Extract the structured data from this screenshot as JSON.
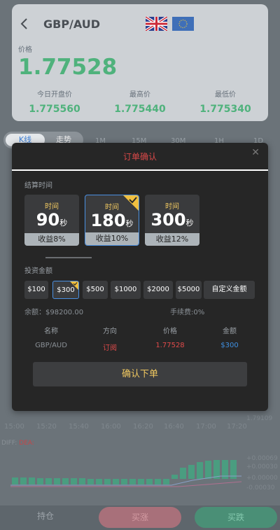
{
  "header": {
    "pair": "GBP/AUD",
    "price_label": "价格",
    "price": "1.77528",
    "stats": [
      {
        "label": "今日开盘价",
        "value": "1.775560"
      },
      {
        "label": "最高价",
        "value": "1.775440"
      },
      {
        "label": "最低价",
        "value": "1.775340"
      }
    ]
  },
  "chart_tabs": {
    "active": "K线",
    "other": "走势"
  },
  "periods": [
    "1M",
    "15M",
    "30M",
    "1H",
    "1D"
  ],
  "time_axis": [
    "15:00",
    "15:20",
    "15:40",
    "16:00",
    "16:20",
    "16:40",
    "17:00",
    "17:20"
  ],
  "y_axis": {
    "price": "1.79109",
    "macd": [
      "+0.00069",
      "+0.00030",
      "+0.00000",
      "-0.00030"
    ]
  },
  "macd": {
    "diff": "DIFF:",
    "dea": "DEA:"
  },
  "bottom": {
    "hold": "持仓",
    "buy": "买涨",
    "sell": "买跌"
  },
  "modal": {
    "title": "订单确认",
    "settlement_label": "结算时间",
    "time_options": [
      {
        "title": "时间",
        "seconds": "90",
        "unit": "秒",
        "profit": "收益8%"
      },
      {
        "title": "时间",
        "seconds": "180",
        "unit": "秒",
        "profit": "收益10%"
      },
      {
        "title": "时间",
        "seconds": "300",
        "unit": "秒",
        "profit": "收益12%"
      }
    ],
    "invest_label": "投资金额",
    "amounts": [
      "$100",
      "$300",
      "$500",
      "$1000",
      "$2000",
      "$5000"
    ],
    "custom_amount": "自定义金额",
    "balance": "余额：$98200.00",
    "fee": "手续费:0%",
    "table": {
      "headers": [
        "名称",
        "方向",
        "价格",
        "金额"
      ],
      "row": [
        "GBP/AUD",
        "订阅",
        "1.77528",
        "$300"
      ]
    },
    "confirm": "确认下单"
  },
  "colors": {
    "accent_green": "#4fb27c",
    "accent_red": "#e04a4a",
    "accent_blue": "#4a90e2",
    "gold": "#f0c860"
  }
}
